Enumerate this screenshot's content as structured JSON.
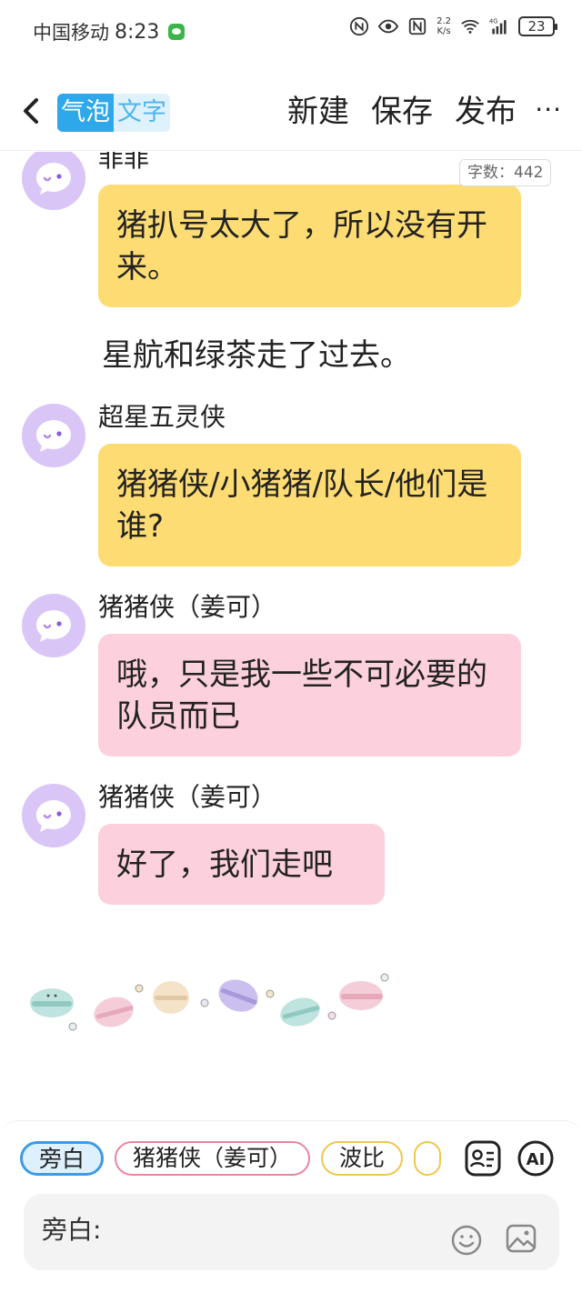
{
  "status_bar": {
    "carrier": "中国移动",
    "time": "8:23",
    "net_speed_value": "2.2",
    "net_speed_unit": "K/s",
    "signal_label": "4G",
    "battery": "23"
  },
  "header": {
    "mode_bubble": "气泡",
    "mode_text": "文字",
    "new_label": "新建",
    "save_label": "保存",
    "publish_label": "发布",
    "more_label": "···"
  },
  "word_count": "字数：442",
  "chat": {
    "msg1": {
      "sender": "菲菲",
      "text": "猪扒号太大了，所以没有开来。"
    },
    "narration1": "星航和绿茶走了过去。",
    "msg2": {
      "sender": "超星五灵侠",
      "text": "猪猪侠/小猪猪/队长/他们是谁?"
    },
    "msg3": {
      "sender": "猪猪侠（姜可）",
      "text": "哦，只是我一些不可必要的队员而已"
    },
    "msg4": {
      "sender": "猪猪侠（姜可）",
      "text": "好了，我们走吧"
    }
  },
  "colors": {
    "bubble_yellow": "#fddc74",
    "bubble_pink": "#fcd0dc",
    "avatar_purple": "#d9c6f6",
    "accent_blue": "#2ea8ea"
  },
  "bottom": {
    "chips": [
      "旁白",
      "猪猪侠（姜可）",
      "波比"
    ],
    "input_label": "旁白:",
    "input_value": "",
    "tools": [
      "contact-card-icon",
      "ai-icon",
      "emoji-icon",
      "image-icon"
    ]
  }
}
